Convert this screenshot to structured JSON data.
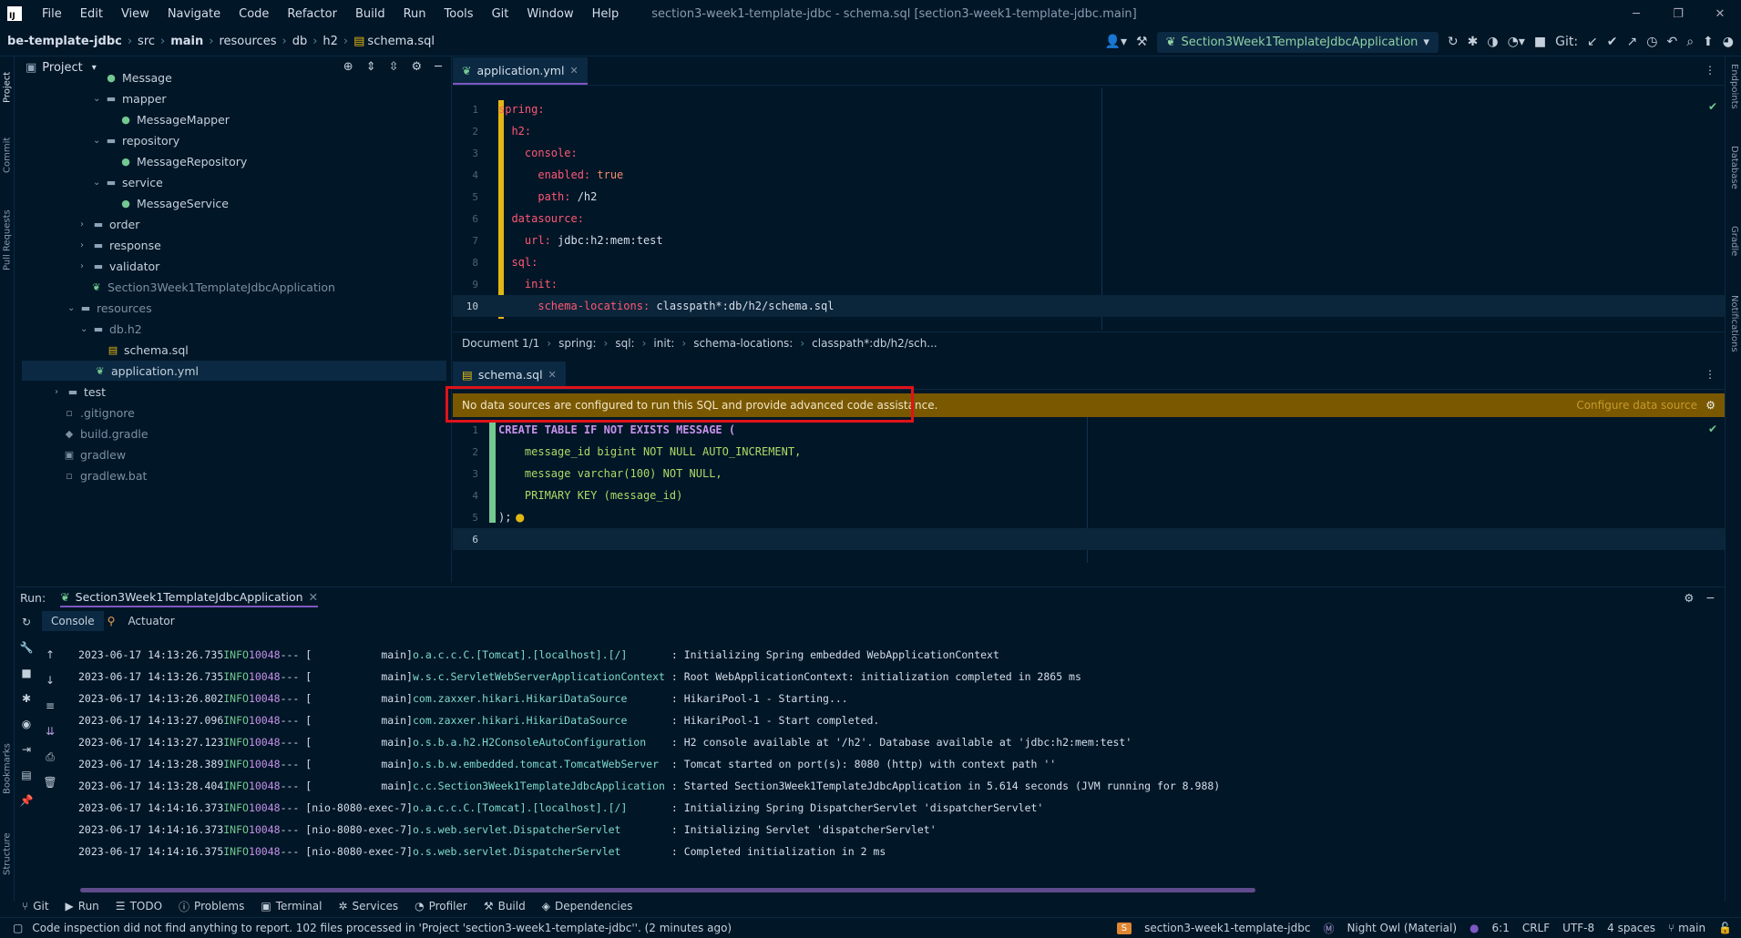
{
  "menu": [
    "File",
    "Edit",
    "View",
    "Navigate",
    "Code",
    "Refactor",
    "Build",
    "Run",
    "Tools",
    "Git",
    "Window",
    "Help"
  ],
  "window_title": "section3-week1-template-jdbc - schema.sql [section3-week1-template-jdbc.main]",
  "breadcrumb": [
    "be-template-jdbc",
    "src",
    "main",
    "resources",
    "db",
    "h2",
    "schema.sql"
  ],
  "run_config": "Section3Week1TemplateJdbcApplication",
  "git_label": "Git:",
  "left_tabs": [
    "Project",
    "Commit",
    "Pull Requests",
    "Bookmarks",
    "Structure"
  ],
  "right_tabs": [
    "Endpoints",
    "Database",
    "Gradle",
    "Notifications"
  ],
  "project": {
    "title": "Project",
    "items": [
      {
        "label": "Message",
        "type": "class"
      },
      {
        "label": "mapper",
        "type": "folder"
      },
      {
        "label": "MessageMapper",
        "type": "class"
      },
      {
        "label": "repository",
        "type": "folder"
      },
      {
        "label": "MessageRepository",
        "type": "class"
      },
      {
        "label": "service",
        "type": "folder"
      },
      {
        "label": "MessageService",
        "type": "class"
      },
      {
        "label": "order",
        "type": "folder"
      },
      {
        "label": "response",
        "type": "folder"
      },
      {
        "label": "validator",
        "type": "folder"
      },
      {
        "label": "Section3Week1TemplateJdbcApplication",
        "type": "spring"
      },
      {
        "label": "resources",
        "type": "folder"
      },
      {
        "label": "db.h2",
        "type": "folder"
      },
      {
        "label": "schema.sql",
        "type": "sql"
      },
      {
        "label": "application.yml",
        "type": "spring"
      },
      {
        "label": "test",
        "type": "folder"
      },
      {
        "label": ".gitignore",
        "type": "file"
      },
      {
        "label": "build.gradle",
        "type": "file"
      },
      {
        "label": "gradlew",
        "type": "file"
      },
      {
        "label": "gradlew.bat",
        "type": "file"
      }
    ]
  },
  "editor1": {
    "tab": "application.yml",
    "lines": [
      {
        "n": "1",
        "key": "spring:",
        "val": ""
      },
      {
        "n": "2",
        "key": "h2:",
        "val": ""
      },
      {
        "n": "3",
        "key": "console:",
        "val": ""
      },
      {
        "n": "4",
        "key": "enabled:",
        "val": " true"
      },
      {
        "n": "5",
        "key": "path:",
        "val": " /h2"
      },
      {
        "n": "6",
        "key": "datasource:",
        "val": ""
      },
      {
        "n": "7",
        "key": "url:",
        "val": " jdbc:h2:mem:test"
      },
      {
        "n": "8",
        "key": "sql:",
        "val": ""
      },
      {
        "n": "9",
        "key": "init:",
        "val": ""
      },
      {
        "n": "10",
        "key": "schema-locations:",
        "val": " classpath*:db/h2/schema.sql"
      }
    ],
    "crumbs": [
      "Document 1/1",
      "spring:",
      "sql:",
      "init:",
      "schema-locations:",
      "classpath*:db/h2/sch..."
    ]
  },
  "editor2": {
    "tab": "schema.sql",
    "banner": "No data sources are configured to run this SQL and provide advanced code assistance.",
    "configure": "Configure data source",
    "lines": [
      {
        "n": "1",
        "text": "CREATE TABLE IF NOT EXISTS MESSAGE ("
      },
      {
        "n": "2",
        "text": "    message_id bigint NOT NULL AUTO_INCREMENT,"
      },
      {
        "n": "3",
        "text": "    message varchar(100) NOT NULL,"
      },
      {
        "n": "4",
        "text": "    PRIMARY KEY (message_id)"
      },
      {
        "n": "5",
        "text": ");"
      },
      {
        "n": "6",
        "text": ""
      }
    ]
  },
  "run": {
    "label": "Run:",
    "tab": "Section3Week1TemplateJdbcApplication",
    "subtabs": [
      "Console",
      "Actuator"
    ],
    "logs": [
      {
        "ts": "2023-06-17 14:13:26.735",
        "lv": "INFO",
        "pid": "10048",
        "th": "--- [           main]",
        "lg": "o.a.c.c.C.[Tomcat].[localhost].[/]      ",
        "msg": " : Initializing Spring embedded WebApplicationContext"
      },
      {
        "ts": "2023-06-17 14:13:26.735",
        "lv": "INFO",
        "pid": "10048",
        "th": "--- [           main]",
        "lg": "w.s.c.ServletWebServerApplicationContext",
        "msg": " : Root WebApplicationContext: initialization completed in 2865 ms"
      },
      {
        "ts": "2023-06-17 14:13:26.802",
        "lv": "INFO",
        "pid": "10048",
        "th": "--- [           main]",
        "lg": "com.zaxxer.hikari.HikariDataSource      ",
        "msg": " : HikariPool-1 - Starting..."
      },
      {
        "ts": "2023-06-17 14:13:27.096",
        "lv": "INFO",
        "pid": "10048",
        "th": "--- [           main]",
        "lg": "com.zaxxer.hikari.HikariDataSource      ",
        "msg": " : HikariPool-1 - Start completed."
      },
      {
        "ts": "2023-06-17 14:13:27.123",
        "lv": "INFO",
        "pid": "10048",
        "th": "--- [           main]",
        "lg": "o.s.b.a.h2.H2ConsoleAutoConfiguration   ",
        "msg": " : H2 console available at '/h2'. Database available at 'jdbc:h2:mem:test'"
      },
      {
        "ts": "2023-06-17 14:13:28.389",
        "lv": "INFO",
        "pid": "10048",
        "th": "--- [           main]",
        "lg": "o.s.b.w.embedded.tomcat.TomcatWebServer ",
        "msg": " : Tomcat started on port(s): 8080 (http) with context path ''"
      },
      {
        "ts": "2023-06-17 14:13:28.404",
        "lv": "INFO",
        "pid": "10048",
        "th": "--- [           main]",
        "lg": "c.c.Section3Week1TemplateJdbcApplication",
        "msg": " : Started Section3Week1TemplateJdbcApplication in 5.614 seconds (JVM running for 8.988)"
      },
      {
        "ts": "2023-06-17 14:14:16.373",
        "lv": "INFO",
        "pid": "10048",
        "th": "--- [nio-8080-exec-7]",
        "lg": "o.a.c.c.C.[Tomcat].[localhost].[/]      ",
        "msg": " : Initializing Spring DispatcherServlet 'dispatcherServlet'"
      },
      {
        "ts": "2023-06-17 14:14:16.373",
        "lv": "INFO",
        "pid": "10048",
        "th": "--- [nio-8080-exec-7]",
        "lg": "o.s.web.servlet.DispatcherServlet       ",
        "msg": " : Initializing Servlet 'dispatcherServlet'"
      },
      {
        "ts": "2023-06-17 14:14:16.375",
        "lv": "INFO",
        "pid": "10048",
        "th": "--- [nio-8080-exec-7]",
        "lg": "o.s.web.servlet.DispatcherServlet       ",
        "msg": " : Completed initialization in 2 ms"
      }
    ]
  },
  "toolwindows": [
    "Git",
    "Run",
    "TODO",
    "Problems",
    "Terminal",
    "Services",
    "Profiler",
    "Build",
    "Dependencies"
  ],
  "status": {
    "message": "Code inspection did not find anything to report. 102 files processed in 'Project 'section3-week1-template-jdbc''. (2 minutes ago)",
    "project_badge": "S",
    "project": "section3-week1-template-jdbc",
    "theme": "Night Owl (Material)",
    "pos": "6:1",
    "eol": "CRLF",
    "enc": "UTF-8",
    "indent": "4 spaces",
    "branch": "main"
  },
  "colors": {
    "bg": "#011627",
    "accent": "#7e57c2",
    "banner": "#7a5800",
    "highlight": "#e0121a"
  }
}
